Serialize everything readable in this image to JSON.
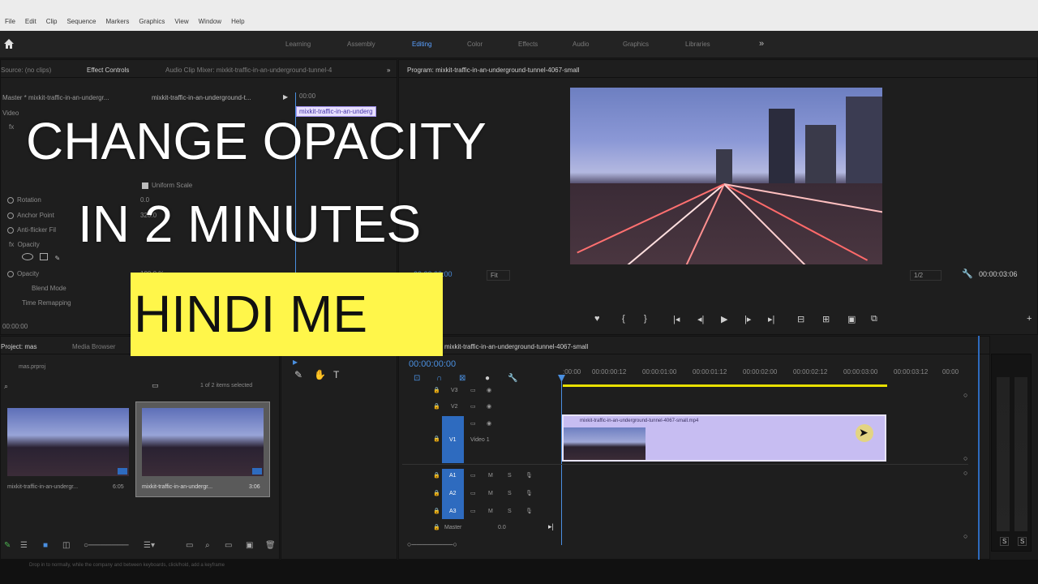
{
  "menu": [
    "File",
    "Edit",
    "Clip",
    "Sequence",
    "Markers",
    "Graphics",
    "View",
    "Window",
    "Help"
  ],
  "workspaces": [
    "Learning",
    "Assembly",
    "Editing",
    "Color",
    "Effects",
    "Audio",
    "Graphics",
    "Libraries"
  ],
  "workspace_more": "»",
  "source_panel": {
    "tabs": [
      "Source: (no clips)",
      "Effect Controls",
      "Audio Clip Mixer: mixkit-traffic-in-an-underground-tunnel-4"
    ],
    "master": "Master * mixkit-traffic-in-an-undergr...",
    "clip_select": "mixkit-traffic-in-an-underground-t...",
    "timecode_top": "00:00",
    "clip_tag": "mixkit-traffic-in-an-underg",
    "video_label": "Video",
    "uniform_scale": "Uniform Scale",
    "rotation": "Rotation",
    "rotation_val": "0.0",
    "anchor_point": "Anchor Point",
    "anchor_val": "320.0",
    "anti_flicker": "Anti-flicker Fil",
    "opacity_group": "Opacity",
    "opacity": "Opacity",
    "opacity_val": "100.0 %",
    "blend_mode": "Blend Mode",
    "time_remapping": "Time Remapping",
    "bottom_timecode": "00:00:00"
  },
  "program": {
    "title": "Program: mixkit-traffic-in-an-underground-tunnel-4067-small",
    "timecode_left": "00:00:00:00",
    "fit": "Fit",
    "resolution": "1/2",
    "timecode_right": "00:00:03:06"
  },
  "project": {
    "tabs": [
      "Project: mas",
      "Media Browser"
    ],
    "file": "mas.prproj",
    "items_selected": "1 of 2 items selected",
    "items": [
      {
        "name": "mixkit-traffic-in-an-undergr...",
        "duration": "6:05"
      },
      {
        "name": "mixkit-traffic-in-an-undergr...",
        "duration": "3:06"
      }
    ]
  },
  "timeline": {
    "title": "mixkit-traffic-in-an-underground-tunnel-4067-small",
    "timecode": "00:00:00:00",
    "ruler": [
      ":00:00",
      "00:00:00:12",
      "00:00:01:00",
      "00:00:01:12",
      "00:00:02:00",
      "00:00:02:12",
      "00:00:03:00",
      "00:00:03:12",
      "00:00"
    ],
    "tracks_video": [
      "V3",
      "V2",
      "V1"
    ],
    "video1_label": "Video 1",
    "tracks_audio": [
      "A1",
      "A2",
      "A3"
    ],
    "mute": "M",
    "solo": "S",
    "master_label": "Master",
    "master_val": "0.0",
    "clip_name": "mixkit-traffic-in-an-underground-tunnel-4067-small.mp4"
  },
  "meter": {
    "left": "S",
    "right": "S"
  },
  "status_text": "Drop in to normally, while the company and between keyboards, click/hold, add a keyframe",
  "overlay": {
    "line1": "CHANGE OPACITY",
    "line2": "IN 2 MINUTES",
    "line3": "HINDI ME"
  },
  "colors": {
    "accent": "#4a8fe0",
    "highlight": "#fff64a",
    "clip": "#c7bdf2",
    "playhead": "#4a8fe0"
  }
}
